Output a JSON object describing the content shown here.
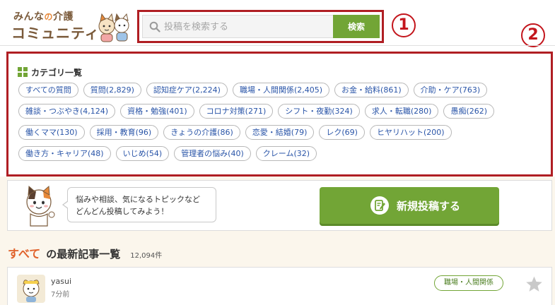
{
  "header": {
    "logo_line1_a": "みんな",
    "logo_line1_no": "の",
    "logo_line1_b": "介護",
    "logo_line2": "コミュニティ",
    "search_placeholder": "投稿を検索する",
    "search_button": "検索",
    "marker1": "1",
    "marker2": "2"
  },
  "categories": {
    "title": "カテゴリ一覧",
    "rows": [
      [
        "すべての質問",
        "質問(2,829)",
        "認知症ケア(2,224)",
        "職場・人間関係(2,405)",
        "お金・給料(861)",
        "介助・ケア(763)"
      ],
      [
        "雑談・つぶやき(4,124)",
        "資格・勉強(401)",
        "コロナ対策(271)",
        "シフト・夜勤(324)",
        "求人・転職(280)",
        "愚痴(262)"
      ],
      [
        "働くママ(130)",
        "採用・教育(96)",
        "きょうの介護(86)",
        "恋愛・結婚(79)",
        "レク(69)",
        "ヒヤリハット(200)"
      ],
      [
        "働き方・キャリア(48)",
        "いじめ(54)",
        "管理者の悩み(40)",
        "クレーム(32)"
      ]
    ]
  },
  "post_panel": {
    "bubble_line1": "悩みや相談、気になるトピックなど",
    "bubble_line2": "どんどん投稿してみよう！",
    "new_post_button": "新規投稿する"
  },
  "list": {
    "accent": "すべて",
    "title": "の最新記事一覧",
    "count": "12,094件"
  },
  "article": {
    "user": "yasui",
    "time": "7分前",
    "tag": "職場・人間関係"
  },
  "colors": {
    "brand_green": "#72a536",
    "highlight_red": "#b01e23",
    "link_blue": "#2a55a8",
    "accent_orange": "#e0612a"
  },
  "icons": [
    "cat-mascot-icon",
    "search-icon",
    "grid-icon",
    "edit-icon",
    "star-icon"
  ]
}
